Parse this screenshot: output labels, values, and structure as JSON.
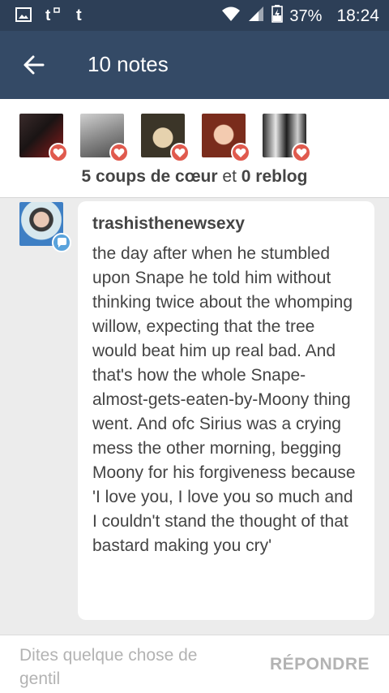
{
  "statusbar": {
    "battery": "37%",
    "time": "18:24",
    "icons": [
      "image-icon",
      "tumblr-notify-icon",
      "tumblr-icon",
      "wifi-icon",
      "signal-icon",
      "battery-icon"
    ]
  },
  "appbar": {
    "title": "10 notes",
    "back_icon": "arrow-left-icon"
  },
  "notes": {
    "avatars": [
      {
        "name": "liker-avatar-1",
        "colors": [
          "#3a2b2b",
          "#8c1b1b"
        ]
      },
      {
        "name": "liker-avatar-2",
        "colors": [
          "#cfcfcf",
          "#6b6b6b"
        ]
      },
      {
        "name": "liker-avatar-3",
        "colors": [
          "#3b3528",
          "#d9c7a5"
        ]
      },
      {
        "name": "liker-avatar-4",
        "colors": [
          "#5a2418",
          "#f0c3a5"
        ]
      },
      {
        "name": "liker-avatar-5",
        "colors": [
          "#1f1f1f",
          "#e8e8e8"
        ]
      }
    ],
    "likes_text": "5 coups de cœur",
    "connector": "et",
    "reblogs_text": "0 reblog"
  },
  "reply": {
    "username": "trashisthenewsexy",
    "message": "the day after when he stumbled upon Snape he told him without thinking twice about the whomping willow, expecting that the tree would beat him up real bad. And that's how the whole Snape-almost-gets-eaten-by-Moony thing went. And ofc Sirius was a crying mess the other morning, begging Moony for his forgiveness because 'I love you, I love you so much and I couldn't stand the thought of that bastard making you cry'"
  },
  "composer": {
    "placeholder": "Dites quelque chose de gentil",
    "button": "RÉPONDRE"
  },
  "colors": {
    "statusbar": "#2d3f57",
    "appbar": "#344a66",
    "heart": "#e05a4e",
    "reply_badge": "#5aa3dc",
    "text": "#444444",
    "muted": "#b3b3b3"
  }
}
